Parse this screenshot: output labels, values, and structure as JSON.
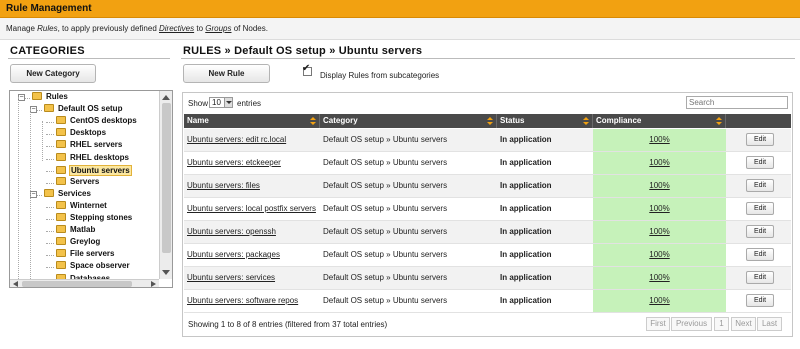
{
  "header": {
    "title": "Rule Management",
    "desc_prefix": "Manage ",
    "desc_rules": "Rules",
    "desc_mid": ", to apply previously defined ",
    "desc_directives": "Directives",
    "desc_to": " to ",
    "desc_groups": "Groups",
    "desc_suffix": " of Nodes."
  },
  "categories": {
    "heading": "CATEGORIES",
    "new_button": "New Category",
    "tree": [
      {
        "label": "Rules",
        "level": 0
      },
      {
        "label": "Default OS setup",
        "level": 1
      },
      {
        "label": "CentOS desktops",
        "level": 2
      },
      {
        "label": "Desktops",
        "level": 2
      },
      {
        "label": "RHEL servers",
        "level": 2
      },
      {
        "label": "RHEL desktops",
        "level": 2
      },
      {
        "label": "Ubuntu servers",
        "level": 2,
        "selected": true
      },
      {
        "label": "Servers",
        "level": 2
      },
      {
        "label": "Services",
        "level": 1
      },
      {
        "label": "Winternet",
        "level": 2
      },
      {
        "label": "Stepping stones",
        "level": 2
      },
      {
        "label": "Matlab",
        "level": 2
      },
      {
        "label": "Greylog",
        "level": 2
      },
      {
        "label": "File servers",
        "level": 2
      },
      {
        "label": "Space observer",
        "level": 2
      },
      {
        "label": "Databases",
        "level": 2
      }
    ]
  },
  "rules": {
    "heading": "RULES » Default OS setup » Ubuntu servers",
    "new_button": "New Rule",
    "subcat_checkbox_label": "Display Rules from subcategories",
    "subcat_checked": true,
    "show_label": "Show",
    "show_value": "10",
    "entries_label": "entries",
    "search_placeholder": "Search",
    "columns": [
      "Name",
      "Category",
      "Status",
      "Compliance",
      ""
    ],
    "rows": [
      {
        "name": "Ubuntu servers: edit rc.local",
        "category": "Default OS setup » Ubuntu servers",
        "status": "In application",
        "compliance": "100%",
        "action": "Edit"
      },
      {
        "name": "Ubuntu servers: etckeeper",
        "category": "Default OS setup » Ubuntu servers",
        "status": "In application",
        "compliance": "100%",
        "action": "Edit"
      },
      {
        "name": "Ubuntu servers: files",
        "category": "Default OS setup » Ubuntu servers",
        "status": "In application",
        "compliance": "100%",
        "action": "Edit"
      },
      {
        "name": "Ubuntu servers: local postfix servers",
        "category": "Default OS setup » Ubuntu servers",
        "status": "In application",
        "compliance": "100%",
        "action": "Edit"
      },
      {
        "name": "Ubuntu servers: openssh",
        "category": "Default OS setup » Ubuntu servers",
        "status": "In application",
        "compliance": "100%",
        "action": "Edit"
      },
      {
        "name": "Ubuntu servers: packages",
        "category": "Default OS setup » Ubuntu servers",
        "status": "In application",
        "compliance": "100%",
        "action": "Edit"
      },
      {
        "name": "Ubuntu servers: services",
        "category": "Default OS setup » Ubuntu servers",
        "status": "In application",
        "compliance": "100%",
        "action": "Edit"
      },
      {
        "name": "Ubuntu servers: software repos",
        "category": "Default OS setup » Ubuntu servers",
        "status": "In application",
        "compliance": "100%",
        "action": "Edit"
      }
    ],
    "info": "Showing 1 to 8 of 8 entries (filtered from 37 total entries)",
    "pager": {
      "first": "First",
      "previous": "Previous",
      "page": "1",
      "next": "Next",
      "last": "Last"
    }
  },
  "colors": {
    "header_bar": "#f2a111",
    "table_header": "#4a4a4a",
    "compliance_ok": "#c6f2ba"
  },
  "icons": {
    "tree_node": "folder-icon",
    "checkbox": "checkmark-icon",
    "sort": "sort-icon"
  }
}
